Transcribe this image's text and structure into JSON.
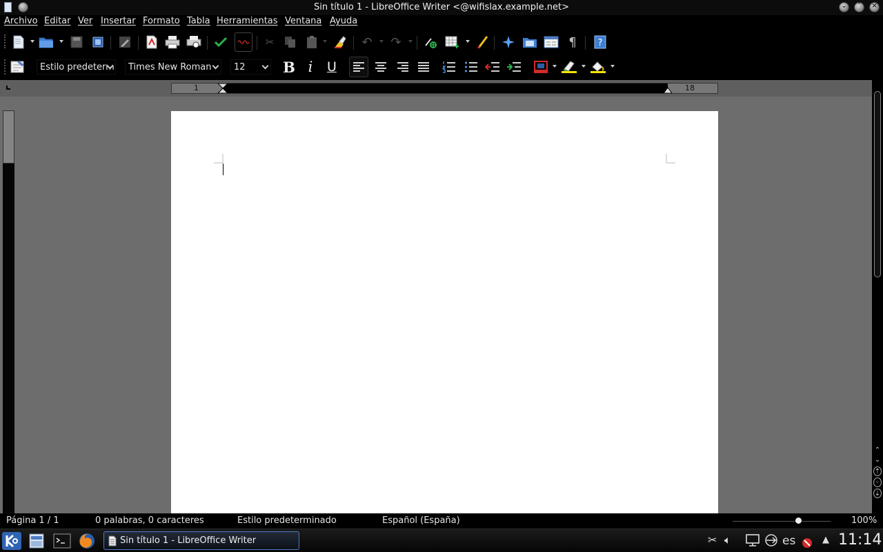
{
  "window": {
    "title": "Sin título 1 - LibreOffice Writer <@wifislax.example.net>"
  },
  "menu": [
    "Archivo",
    "Editar",
    "Ver",
    "Insertar",
    "Formato",
    "Tabla",
    "Herramientas",
    "Ventana",
    "Ayuda"
  ],
  "formatting": {
    "paragraph_style": "Estilo predeterminado",
    "font_name": "Times New Roman",
    "font_size": "12",
    "bold_glyph": "B",
    "italic_glyph": "i",
    "underline_glyph": "U"
  },
  "ruler": {
    "left_number": "1",
    "right_number": "18"
  },
  "status": {
    "page": "Página 1 / 1",
    "words": "0 palabras, 0 caracteres",
    "style": "Estilo predeterminado",
    "language": "Español (España)",
    "zoom": "100%",
    "zoom_level": 100
  },
  "taskbar": {
    "window_label": "Sin título 1 - LibreOffice Writer",
    "keyboard_layout": "es",
    "clock": "11:14"
  },
  "colors": {
    "accent_blue": "#4f7cc4",
    "pdf_red": "#d42a2a",
    "check_green": "#2bb24c",
    "highlight_yellow": "#f2e600"
  }
}
